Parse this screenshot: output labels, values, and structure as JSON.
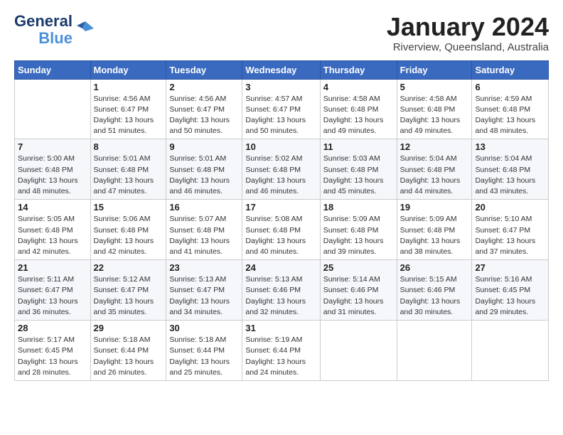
{
  "header": {
    "logo_line1": "General",
    "logo_line2": "Blue",
    "month": "January 2024",
    "location": "Riverview, Queensland, Australia"
  },
  "days_of_week": [
    "Sunday",
    "Monday",
    "Tuesday",
    "Wednesday",
    "Thursday",
    "Friday",
    "Saturday"
  ],
  "weeks": [
    [
      {
        "day": "",
        "info": ""
      },
      {
        "day": "1",
        "info": "Sunrise: 4:56 AM\nSunset: 6:47 PM\nDaylight: 13 hours\nand 51 minutes."
      },
      {
        "day": "2",
        "info": "Sunrise: 4:56 AM\nSunset: 6:47 PM\nDaylight: 13 hours\nand 50 minutes."
      },
      {
        "day": "3",
        "info": "Sunrise: 4:57 AM\nSunset: 6:47 PM\nDaylight: 13 hours\nand 50 minutes."
      },
      {
        "day": "4",
        "info": "Sunrise: 4:58 AM\nSunset: 6:48 PM\nDaylight: 13 hours\nand 49 minutes."
      },
      {
        "day": "5",
        "info": "Sunrise: 4:58 AM\nSunset: 6:48 PM\nDaylight: 13 hours\nand 49 minutes."
      },
      {
        "day": "6",
        "info": "Sunrise: 4:59 AM\nSunset: 6:48 PM\nDaylight: 13 hours\nand 48 minutes."
      }
    ],
    [
      {
        "day": "7",
        "info": "Sunrise: 5:00 AM\nSunset: 6:48 PM\nDaylight: 13 hours\nand 48 minutes."
      },
      {
        "day": "8",
        "info": "Sunrise: 5:01 AM\nSunset: 6:48 PM\nDaylight: 13 hours\nand 47 minutes."
      },
      {
        "day": "9",
        "info": "Sunrise: 5:01 AM\nSunset: 6:48 PM\nDaylight: 13 hours\nand 46 minutes."
      },
      {
        "day": "10",
        "info": "Sunrise: 5:02 AM\nSunset: 6:48 PM\nDaylight: 13 hours\nand 46 minutes."
      },
      {
        "day": "11",
        "info": "Sunrise: 5:03 AM\nSunset: 6:48 PM\nDaylight: 13 hours\nand 45 minutes."
      },
      {
        "day": "12",
        "info": "Sunrise: 5:04 AM\nSunset: 6:48 PM\nDaylight: 13 hours\nand 44 minutes."
      },
      {
        "day": "13",
        "info": "Sunrise: 5:04 AM\nSunset: 6:48 PM\nDaylight: 13 hours\nand 43 minutes."
      }
    ],
    [
      {
        "day": "14",
        "info": "Sunrise: 5:05 AM\nSunset: 6:48 PM\nDaylight: 13 hours\nand 42 minutes."
      },
      {
        "day": "15",
        "info": "Sunrise: 5:06 AM\nSunset: 6:48 PM\nDaylight: 13 hours\nand 42 minutes."
      },
      {
        "day": "16",
        "info": "Sunrise: 5:07 AM\nSunset: 6:48 PM\nDaylight: 13 hours\nand 41 minutes."
      },
      {
        "day": "17",
        "info": "Sunrise: 5:08 AM\nSunset: 6:48 PM\nDaylight: 13 hours\nand 40 minutes."
      },
      {
        "day": "18",
        "info": "Sunrise: 5:09 AM\nSunset: 6:48 PM\nDaylight: 13 hours\nand 39 minutes."
      },
      {
        "day": "19",
        "info": "Sunrise: 5:09 AM\nSunset: 6:48 PM\nDaylight: 13 hours\nand 38 minutes."
      },
      {
        "day": "20",
        "info": "Sunrise: 5:10 AM\nSunset: 6:47 PM\nDaylight: 13 hours\nand 37 minutes."
      }
    ],
    [
      {
        "day": "21",
        "info": "Sunrise: 5:11 AM\nSunset: 6:47 PM\nDaylight: 13 hours\nand 36 minutes."
      },
      {
        "day": "22",
        "info": "Sunrise: 5:12 AM\nSunset: 6:47 PM\nDaylight: 13 hours\nand 35 minutes."
      },
      {
        "day": "23",
        "info": "Sunrise: 5:13 AM\nSunset: 6:47 PM\nDaylight: 13 hours\nand 34 minutes."
      },
      {
        "day": "24",
        "info": "Sunrise: 5:13 AM\nSunset: 6:46 PM\nDaylight: 13 hours\nand 32 minutes."
      },
      {
        "day": "25",
        "info": "Sunrise: 5:14 AM\nSunset: 6:46 PM\nDaylight: 13 hours\nand 31 minutes."
      },
      {
        "day": "26",
        "info": "Sunrise: 5:15 AM\nSunset: 6:46 PM\nDaylight: 13 hours\nand 30 minutes."
      },
      {
        "day": "27",
        "info": "Sunrise: 5:16 AM\nSunset: 6:45 PM\nDaylight: 13 hours\nand 29 minutes."
      }
    ],
    [
      {
        "day": "28",
        "info": "Sunrise: 5:17 AM\nSunset: 6:45 PM\nDaylight: 13 hours\nand 28 minutes."
      },
      {
        "day": "29",
        "info": "Sunrise: 5:18 AM\nSunset: 6:44 PM\nDaylight: 13 hours\nand 26 minutes."
      },
      {
        "day": "30",
        "info": "Sunrise: 5:18 AM\nSunset: 6:44 PM\nDaylight: 13 hours\nand 25 minutes."
      },
      {
        "day": "31",
        "info": "Sunrise: 5:19 AM\nSunset: 6:44 PM\nDaylight: 13 hours\nand 24 minutes."
      },
      {
        "day": "",
        "info": ""
      },
      {
        "day": "",
        "info": ""
      },
      {
        "day": "",
        "info": ""
      }
    ]
  ]
}
